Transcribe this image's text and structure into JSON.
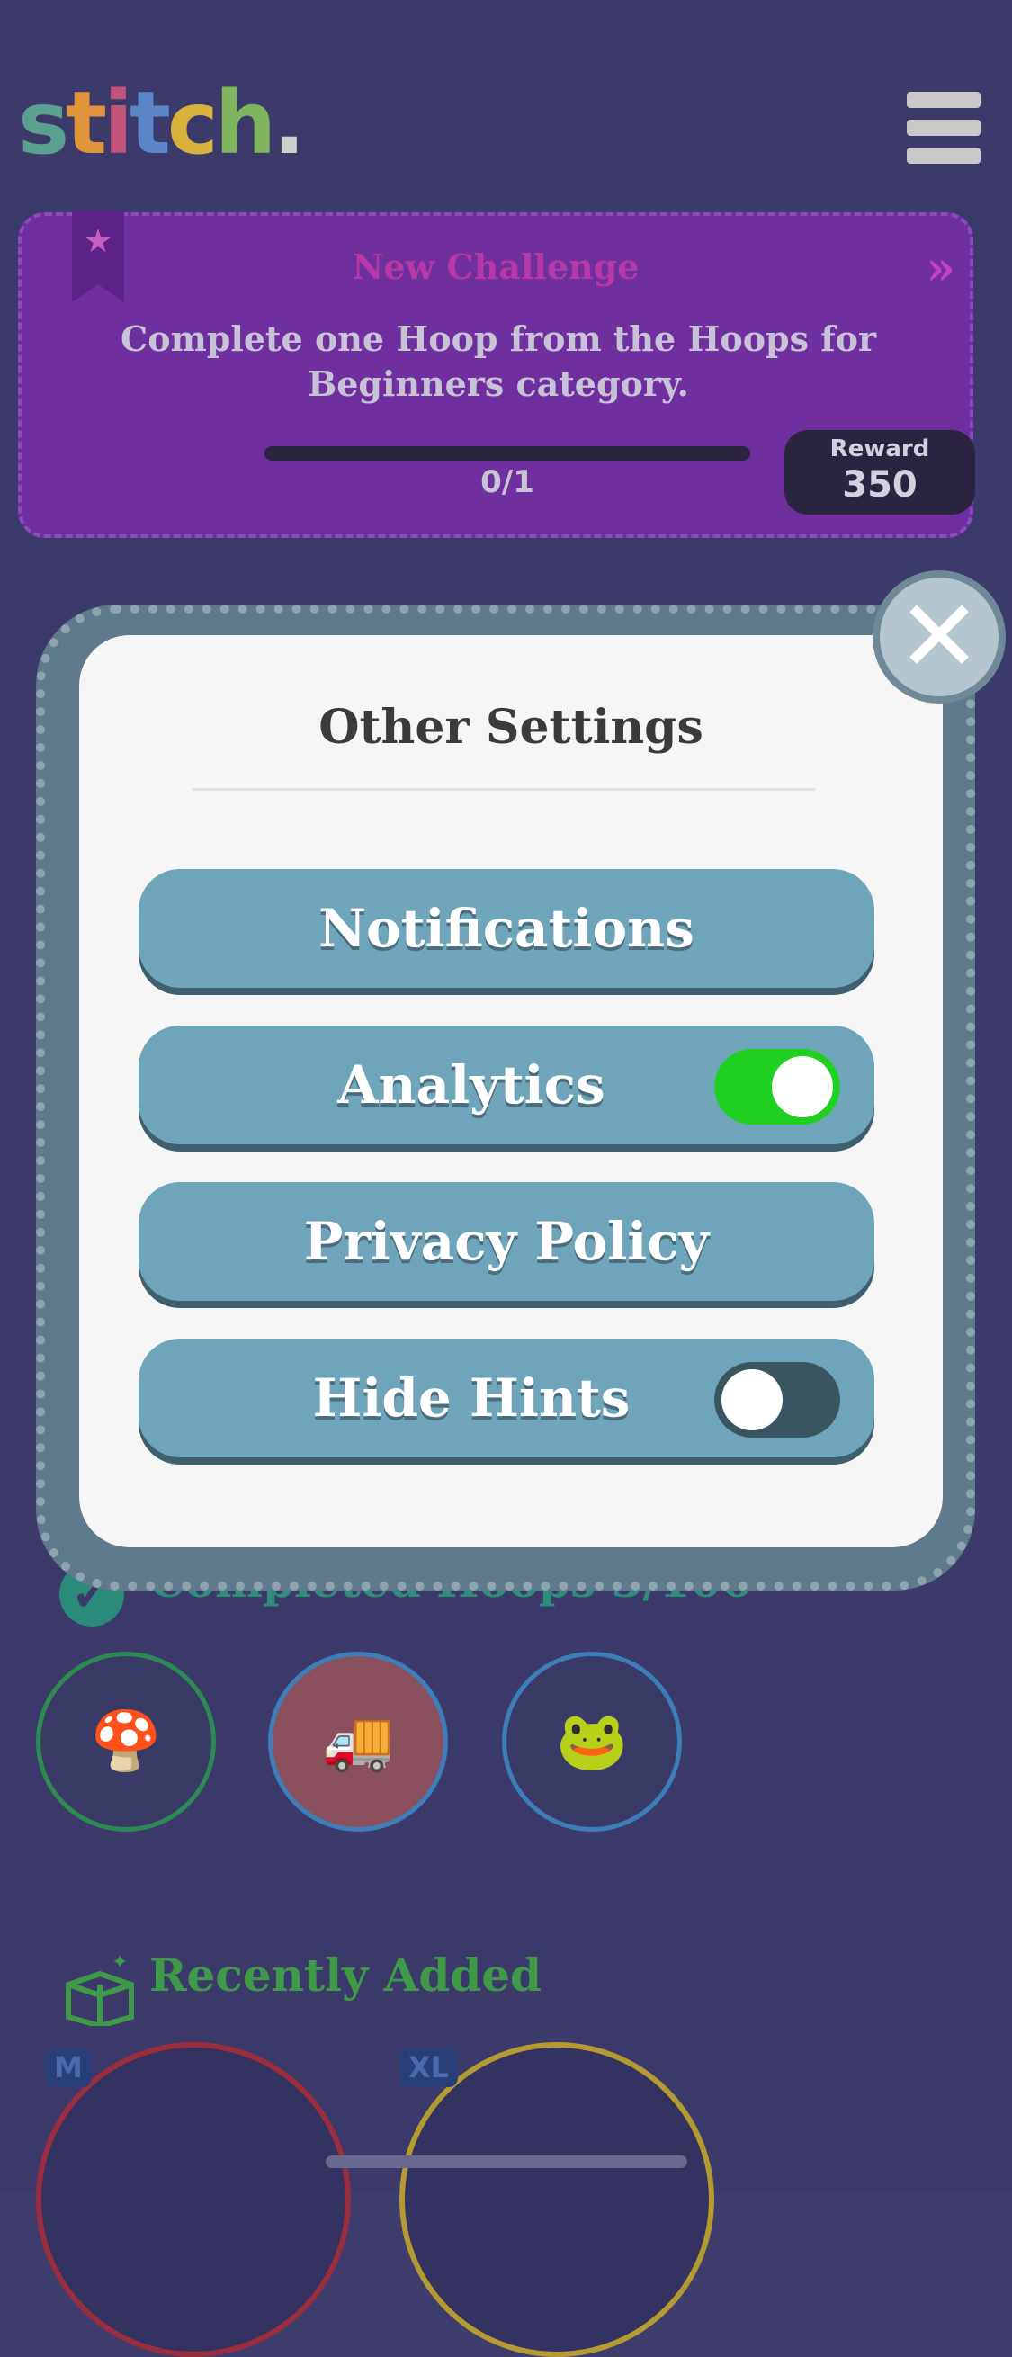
{
  "header": {
    "logo_text": "stitch.",
    "menu_icon": "hamburger-menu-icon"
  },
  "challenge": {
    "title": "New Challenge",
    "description": "Complete one Hoop from the Hoops for Beginners category.",
    "progress_text": "0/1",
    "progress_fraction": 0,
    "reward_label": "Reward",
    "reward_value": "350",
    "ribbon_icon": "star-bookmark-icon",
    "arrows_icon": "double-chevron-right-icon"
  },
  "background": {
    "completed_label": "Completed Hoops 3/100",
    "recent_label": "Recently Added",
    "badges": [
      "M",
      "XL"
    ]
  },
  "modal": {
    "title": "Other Settings",
    "options": [
      {
        "label": "Notifications"
      },
      {
        "label": "Analytics",
        "toggle": true
      },
      {
        "label": "Privacy Policy"
      },
      {
        "label": "Hide Hints",
        "toggle": false
      }
    ],
    "close_icon": "close-x-icon"
  },
  "colors": {
    "button": "#6fa5bb",
    "toggle_on": "#1fd022",
    "toggle_off": "#3b5560",
    "challenge_bg": "#6f2f9e"
  }
}
